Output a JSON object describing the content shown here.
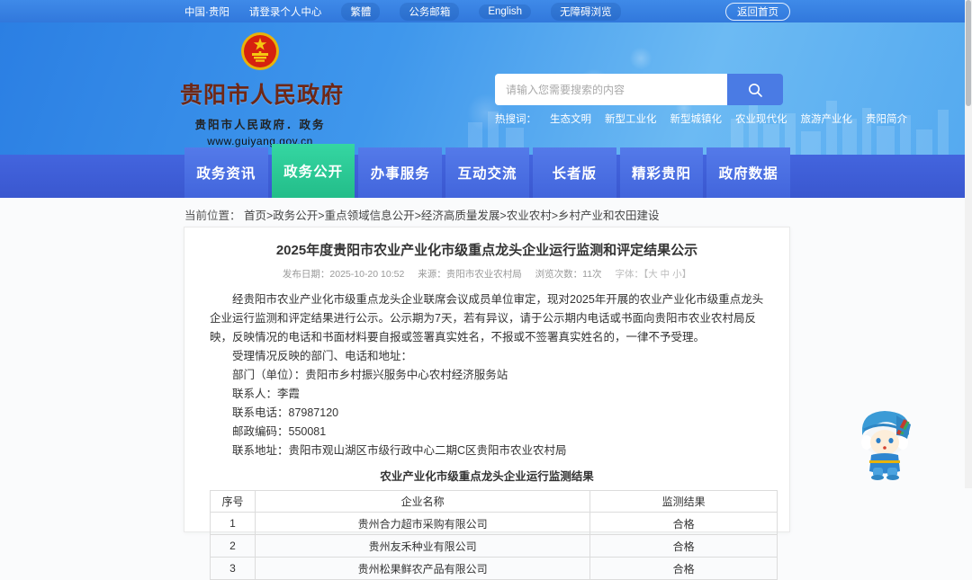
{
  "topbar": {
    "links": [
      "中国·贵阳",
      "请登录个人中心",
      "繁體",
      "公务邮箱",
      "English",
      "无障碍浏览"
    ],
    "home_button": "返回首页"
  },
  "header": {
    "site_title": "贵阳市人民政府",
    "site_subtitle": "贵阳市人民政府．政务",
    "site_url": "www.guiyang.gov.cn",
    "search_placeholder": "请输入您需要搜索的内容",
    "hot_label": "热搜词：",
    "hot_words": [
      "生态文明",
      "新型工业化",
      "新型城镇化",
      "农业现代化",
      "旅游产业化",
      "贵阳简介"
    ]
  },
  "nav": {
    "items": [
      {
        "label": "政务资讯",
        "active": false
      },
      {
        "label": "政务公开",
        "active": true
      },
      {
        "label": "办事服务",
        "active": false
      },
      {
        "label": "互动交流",
        "active": false
      },
      {
        "label": "长者版",
        "active": false
      },
      {
        "label": "精彩贵阳",
        "active": false
      },
      {
        "label": "政府数据",
        "active": false
      }
    ]
  },
  "breadcrumb": {
    "label": "当前位置：",
    "path": "首页>政务公开>重点领域信息公开>经济高质量发展>农业农村>乡村产业和农田建设"
  },
  "article": {
    "title": "2025年度贵阳市农业产业化市级重点龙头企业运行监测和评定结果公示",
    "meta": {
      "publish": "发布日期：2025-10-20 10:52",
      "source": "来源：贵阳市农业农村局",
      "views": "浏览次数：11次",
      "font": "字体：【大 中 小】"
    },
    "paragraphs": [
      "经贵阳市农业产业化市级重点龙头企业联席会议成员单位审定，现对2025年开展的农业产业化市级重点龙头企业运行监测和评定结果进行公示。公示期为7天，若有异议，请于公示期内电话或书面向贵阳市农业农村局反映，反映情况的电话和书面材料要自报或签署真实姓名，不报或不签署真实姓名的，一律不予受理。",
      "受理情况反映的部门、电话和地址：",
      "部门（单位）：贵阳市乡村振兴服务中心农村经济服务站",
      "联系人：李霞",
      "联系电话：87987120",
      "邮政编码：550081",
      "联系地址：贵阳市观山湖区市级行政中心二期C区贵阳市农业农村局"
    ],
    "table_title": "农业产业化市级重点龙头企业运行监测结果",
    "table": {
      "headers": [
        "序号",
        "企业名称",
        "监测结果"
      ],
      "rows": [
        {
          "no": "1",
          "name": "贵州合力超市采购有限公司",
          "result": "合格"
        },
        {
          "no": "2",
          "name": "贵州友禾种业有限公司",
          "result": "合格"
        },
        {
          "no": "3",
          "name": "贵州松果鲜农产品有限公司",
          "result": "合格"
        }
      ]
    }
  },
  "colors": {
    "topbar_blue": "#3585e3",
    "header_blue": "#4a9ced",
    "nav_blue": "#3c5ed9",
    "tab_blue": "#4d74e6",
    "active_tab_green": "#2dc794",
    "search_button_blue": "#4a7be4",
    "site_title_maroon": "#6e2817"
  }
}
